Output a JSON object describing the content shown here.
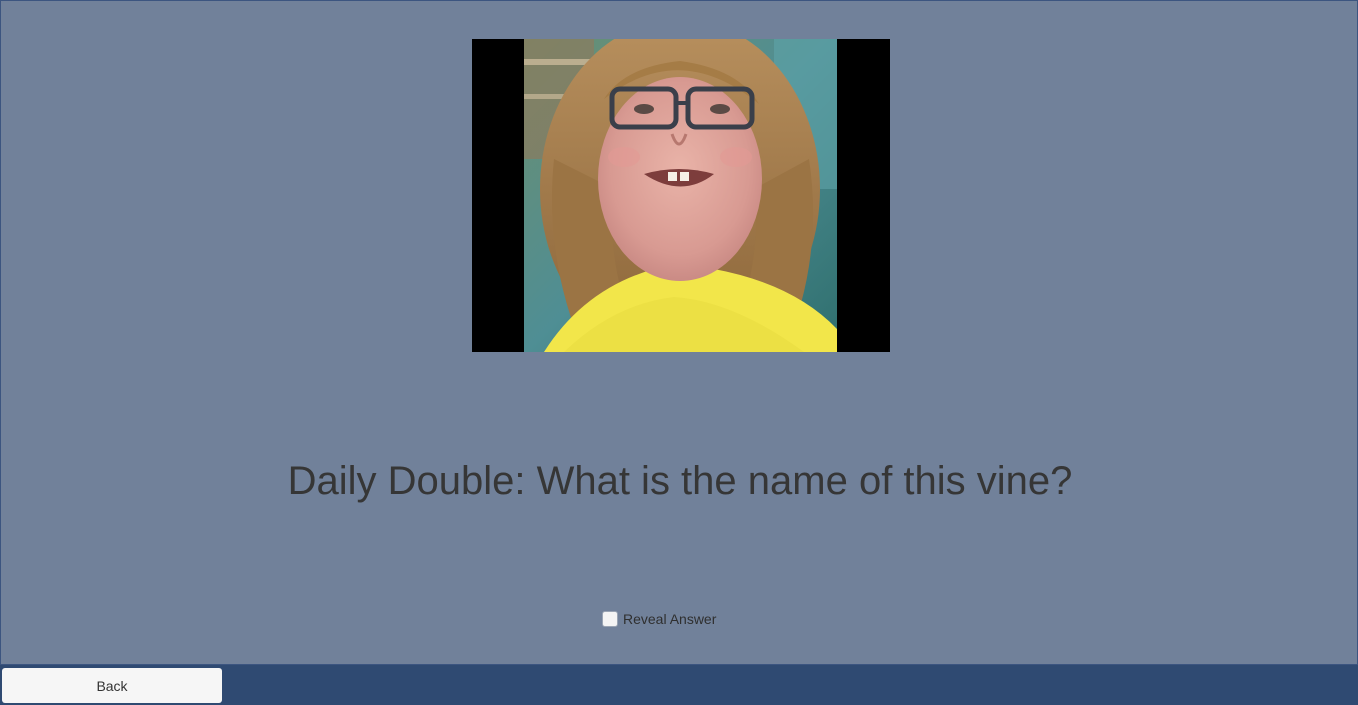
{
  "question": {
    "text": "Daily Double: What is the name of this vine?"
  },
  "media": {
    "kind": "video-thumbnail"
  },
  "reveal": {
    "label": "Reveal Answer",
    "checked": false
  },
  "footer": {
    "back_label": "Back"
  },
  "colors": {
    "panel": "#71819a",
    "footer": "#2f4a72",
    "text": "#363636",
    "button": "#f6f6f6"
  }
}
